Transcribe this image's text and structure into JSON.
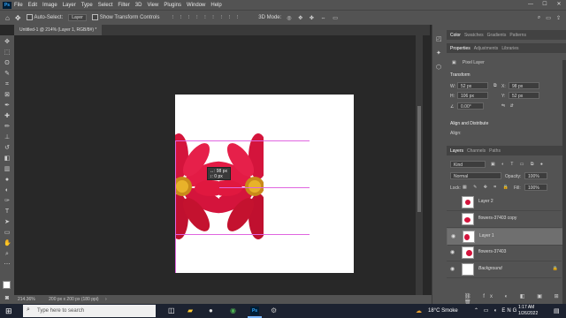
{
  "menu": [
    "File",
    "Edit",
    "Image",
    "Layer",
    "Type",
    "Select",
    "Filter",
    "3D",
    "View",
    "Plugins",
    "Window",
    "Help"
  ],
  "options": {
    "auto_select_label": "Auto-Select:",
    "auto_select_value": "Layer",
    "show_transform_label": "Show Transform Controls"
  },
  "document_tab": "Untitled-1 @ 214% (Layer 1, RGB/8#) *",
  "measure": {
    "line1": "↔: 98 px",
    "line2": "↕: 0 px"
  },
  "status": {
    "zoom": "214.36%",
    "size": "200 px x 200 px (180 ppi)"
  },
  "top_panel_tabs": [
    "Color",
    "Swatches",
    "Gradients",
    "Patterns"
  ],
  "props_tabs": [
    "Properties",
    "Adjustments",
    "Libraries"
  ],
  "props": {
    "kind": "Pixel Layer",
    "transform": "Transform",
    "w": "52 px",
    "x": "98 px",
    "h": "106 px",
    "y": "52 px",
    "angle": "0.00°",
    "align": "Align and Distribute",
    "align_sub": "Align:"
  },
  "layers_tabs": [
    "Layers",
    "Channels",
    "Paths"
  ],
  "layers_ctrl": {
    "kind": "Kind",
    "blend": "Normal",
    "opacity_label": "Opacity:",
    "opacity": "100%",
    "lock_label": "Lock:",
    "fill_label": "Fill:",
    "fill": "100%"
  },
  "layers": [
    {
      "name": "Layer 2",
      "visible": false,
      "selected": false
    },
    {
      "name": "flowers-37403 copy",
      "visible": false,
      "selected": false
    },
    {
      "name": "Layer 1",
      "visible": true,
      "selected": true
    },
    {
      "name": "flowers-37403",
      "visible": true,
      "selected": false
    },
    {
      "name": "Background",
      "visible": true,
      "selected": false
    }
  ],
  "taskbar": {
    "search_placeholder": "Type here to search",
    "weather": "18°C  Smoke",
    "time": "1:17 AM",
    "date": "1/26/2022"
  },
  "colors": {
    "accent": "#31a8ff",
    "flower": "#d4143c",
    "guide": "#e066e0"
  }
}
